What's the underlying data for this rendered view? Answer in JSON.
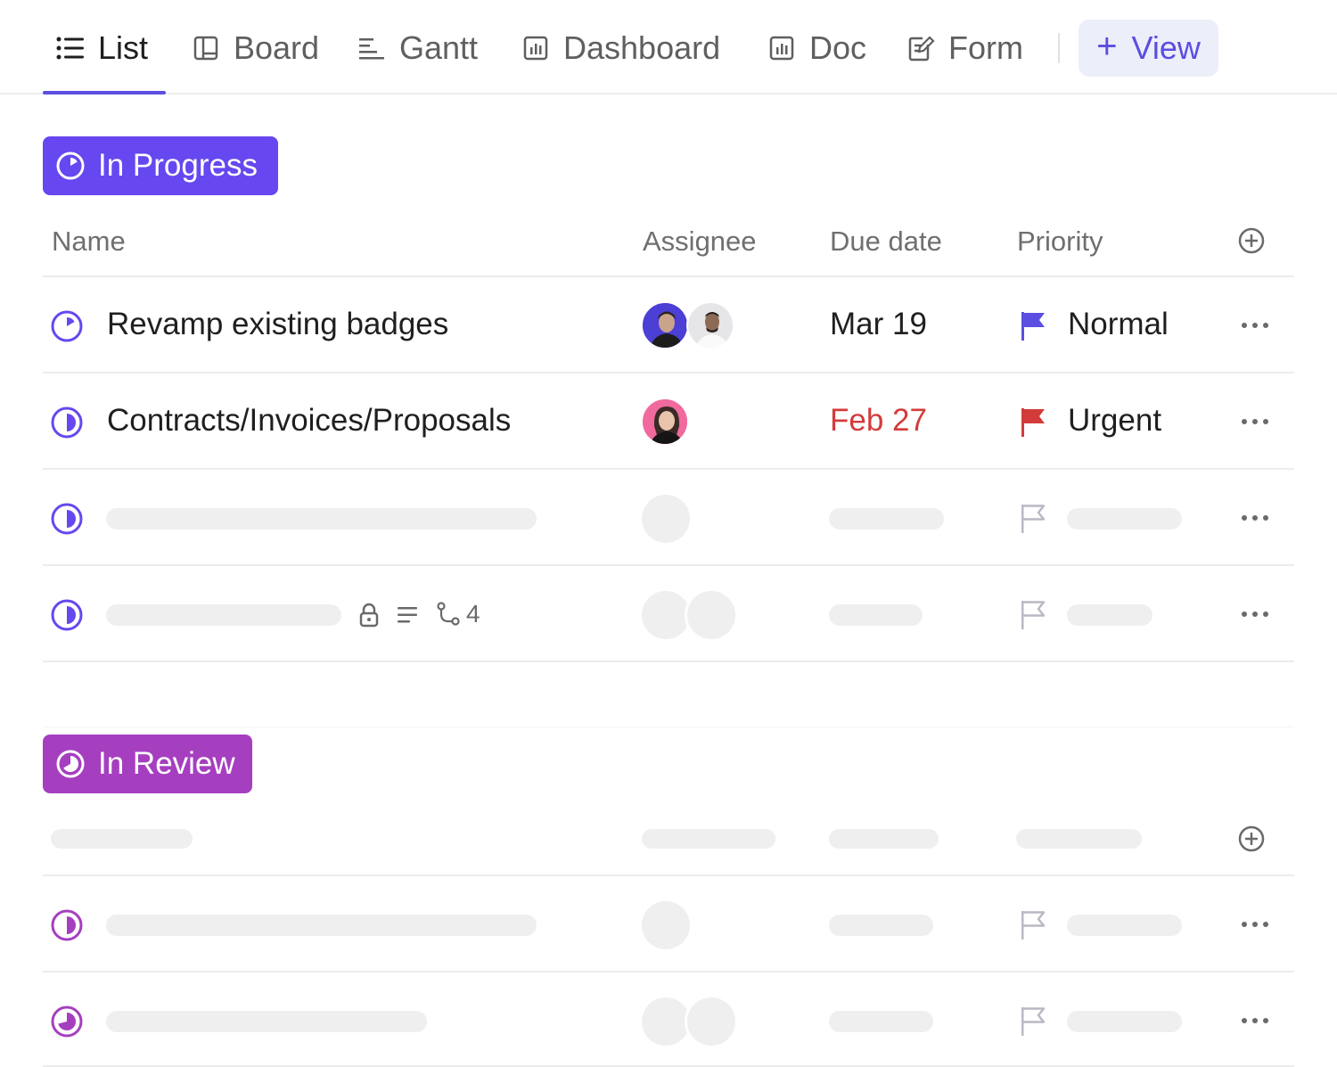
{
  "tabs": [
    {
      "label": "List",
      "icon": "list-icon",
      "active": true
    },
    {
      "label": "Board",
      "icon": "board-icon",
      "active": false
    },
    {
      "label": "Gantt",
      "icon": "gantt-icon",
      "active": false
    },
    {
      "label": "Dashboard",
      "icon": "dashboard-icon",
      "active": false
    },
    {
      "label": "Doc",
      "icon": "doc-icon",
      "active": false
    },
    {
      "label": "Form",
      "icon": "form-icon",
      "active": false
    }
  ],
  "add_view": {
    "label": "View",
    "icon": "plus-icon"
  },
  "colors": {
    "accent": "#5b4ee0",
    "in_progress": "#6647f0",
    "in_review": "#a53fc0",
    "urgent": "#d33b3b",
    "normal_flag": "#5b4ee0",
    "skeleton": "#efefef"
  },
  "groups": [
    {
      "status": "In Progress",
      "columns": {
        "name": "Name",
        "assignee": "Assignee",
        "due_date": "Due date",
        "priority": "Priority"
      },
      "tasks": [
        {
          "name": "Revamp existing badges",
          "assignees": [
            "avatar-man-1",
            "avatar-man-2"
          ],
          "due_date": "Mar 19",
          "overdue": false,
          "priority": "Normal"
        },
        {
          "name": "Contracts/Invoices/Proposals",
          "assignees": [
            "avatar-woman-1"
          ],
          "due_date": "Feb 27",
          "overdue": true,
          "priority": "Urgent"
        }
      ],
      "placeholder_row_meta": {
        "subtask_count": "4",
        "icons": [
          "lock-icon",
          "description-icon",
          "subtasks-icon"
        ]
      }
    },
    {
      "status": "In Review",
      "columns": {},
      "tasks": []
    }
  ]
}
